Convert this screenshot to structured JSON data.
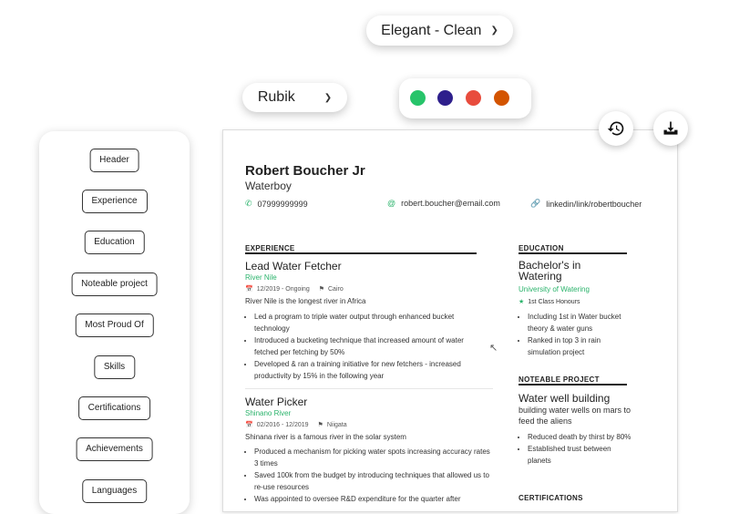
{
  "template_select": {
    "value": "Elegant - Clean"
  },
  "font_select": {
    "value": "Rubik"
  },
  "colors": [
    "#27c46a",
    "#2e1f8c",
    "#e84c3d",
    "#d35400"
  ],
  "sidebar": {
    "items": [
      "Header",
      "Experience",
      "Education",
      "Noteable project",
      "Most Proud Of",
      "Skills",
      "Certifications",
      "Achievements",
      "Languages"
    ]
  },
  "resume": {
    "name": "Robert Boucher Jr",
    "role": "Waterboy",
    "phone": "07999999999",
    "email": "robert.boucher@email.com",
    "linkedin": "linkedin/link/robertboucher",
    "experience_title": "EXPERIENCE",
    "jobs": [
      {
        "title": "Lead Water Fetcher",
        "company": "River Nile",
        "dates": "12/2019 - Ongoing",
        "location": "Cairo",
        "description": "River Nile is the longest river in Africa",
        "bullets": [
          "Led a program to triple water output through enhanced bucket technology",
          "Introduced a bucketing technique that increased amount of water fetched per fetching by 50%",
          "Developed & ran a training initiative for new fetchers - increased productivity by 15% in the following year"
        ]
      },
      {
        "title": "Water Picker",
        "company": "Shinano River",
        "dates": "02/2016 - 12/2019",
        "location": "Niigata",
        "description": "Shinana river is a famous river in the solar system",
        "bullets": [
          "Produced a mechanism for picking water spots increasing accuracy rates 3 times",
          "Saved 100k from the budget by introducing techniques that allowed us to re-use resources",
          "Was appointed to oversee R&D expenditure for the quarter after"
        ]
      }
    ],
    "education_title": "EDUCATION",
    "education": {
      "degree": "Bachelor's in Watering",
      "school": "University of Watering",
      "honour": "1st Class Honours",
      "bullets": [
        "Including 1st in Water bucket theory & water guns",
        "Ranked in top 3 in rain simulation project"
      ]
    },
    "project_title": "NOTEABLE PROJECT",
    "project": {
      "name": "Water well building",
      "description": "building water wells on mars to feed the aliens",
      "bullets": [
        "Reduced death by thirst by 80%",
        "Established trust between planets"
      ]
    },
    "certifications_title": "CERTIFICATIONS"
  }
}
